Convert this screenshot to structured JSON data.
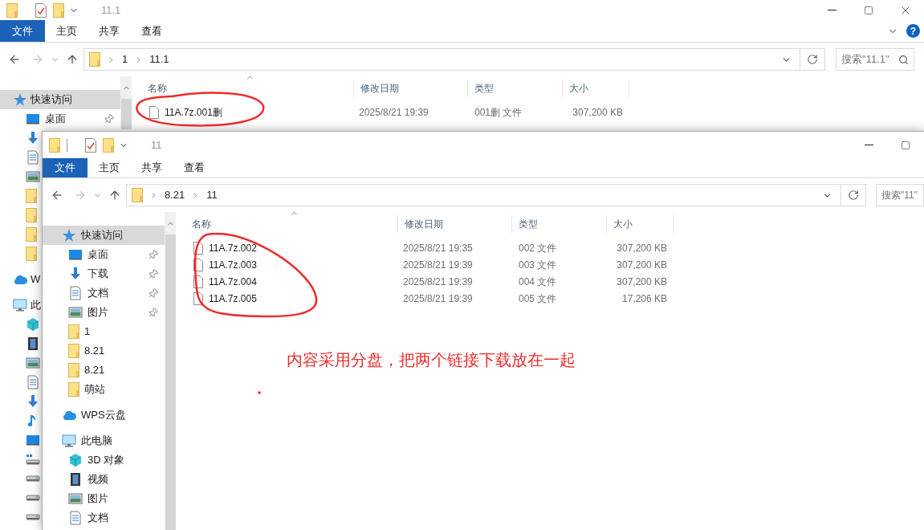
{
  "windows": [
    {
      "title": "11.1",
      "help": "?",
      "ribbon_tabs": [
        {
          "label": "文件",
          "kind": "menu"
        },
        {
          "label": "主页",
          "kind": "tab"
        },
        {
          "label": "共享",
          "kind": "tab"
        },
        {
          "label": "查看",
          "kind": "tab"
        }
      ],
      "path": [
        "1",
        "11.1"
      ],
      "search": {
        "placeholder": "搜索\"11.1\""
      },
      "sidebar": [
        {
          "label": "快速访问",
          "kind": "star",
          "selected": true,
          "children": [
            {
              "label": "桌面",
              "kind": "desktop",
              "pinned": true
            },
            {
              "kind": "download"
            },
            {
              "kind": "document"
            },
            {
              "kind": "picture"
            },
            {
              "kind": "folder"
            },
            {
              "kind": "folder"
            },
            {
              "kind": "folder"
            },
            {
              "kind": "folder"
            }
          ]
        },
        {
          "label": "W",
          "kind": "cloud",
          "selected": false
        },
        {
          "label": "此",
          "kind": "computer",
          "selected": false,
          "children": [
            {
              "kind": "cube"
            },
            {
              "kind": "video"
            },
            {
              "kind": "picture"
            },
            {
              "kind": "document"
            },
            {
              "kind": "download"
            },
            {
              "kind": "music"
            },
            {
              "kind": "desktop"
            },
            {
              "kind": "drive-windows"
            },
            {
              "kind": "drive"
            },
            {
              "kind": "drive"
            },
            {
              "kind": "drive"
            }
          ]
        }
      ],
      "columns": [
        "名称",
        "修改日期",
        "类型",
        "大小"
      ],
      "files": [
        {
          "name": "11A.7z.001删",
          "date": "2025/8/21 19:39",
          "type": "001删 文件",
          "size": "307,200 KB"
        }
      ]
    },
    {
      "title": "11",
      "ribbon_tabs": [
        {
          "label": "文件",
          "kind": "menu"
        },
        {
          "label": "主页",
          "kind": "tab"
        },
        {
          "label": "共享",
          "kind": "tab"
        },
        {
          "label": "查看",
          "kind": "tab"
        }
      ],
      "path": [
        "8.21",
        "11"
      ],
      "search": {
        "placeholder": "搜索\"11\""
      },
      "sidebar": [
        {
          "label": "快速访问",
          "kind": "star",
          "selected": true,
          "children": [
            {
              "label": "桌面",
              "kind": "desktop",
              "pinned": true
            },
            {
              "label": "下载",
              "kind": "download",
              "pinned": true
            },
            {
              "label": "文档",
              "kind": "document",
              "pinned": true
            },
            {
              "label": "图片",
              "kind": "picture",
              "pinned": true
            },
            {
              "label": "1",
              "kind": "folder"
            },
            {
              "label": "8.21",
              "kind": "folder"
            },
            {
              "label": "8.21",
              "kind": "folder"
            },
            {
              "label": "萌站",
              "kind": "folder"
            }
          ]
        },
        {
          "label": "WPS云盘",
          "kind": "cloud",
          "selected": false
        },
        {
          "label": "此电脑",
          "kind": "computer",
          "selected": false,
          "children": [
            {
              "label": "3D 对象",
              "kind": "cube"
            },
            {
              "label": "视频",
              "kind": "video"
            },
            {
              "label": "图片",
              "kind": "picture"
            },
            {
              "label": "文档",
              "kind": "document"
            }
          ]
        }
      ],
      "columns": [
        "名称",
        "修改日期",
        "类型",
        "大小"
      ],
      "files": [
        {
          "name": "11A.7z.002",
          "date": "2025/8/21 19:35",
          "type": "002 文件",
          "size": "307,200 KB"
        },
        {
          "name": "11A.7z.003",
          "date": "2025/8/21 19:39",
          "type": "003 文件",
          "size": "307,200 KB"
        },
        {
          "name": "11A.7z.004",
          "date": "2025/8/21 19:39",
          "type": "004 文件",
          "size": "307,200 KB"
        },
        {
          "name": "11A.7z.005",
          "date": "2025/8/21 19:39",
          "type": "005 文件",
          "size": "17,206 KB"
        }
      ]
    }
  ],
  "annotation": {
    "text": "内容采用分盘，把两个链接下载放在一起"
  }
}
